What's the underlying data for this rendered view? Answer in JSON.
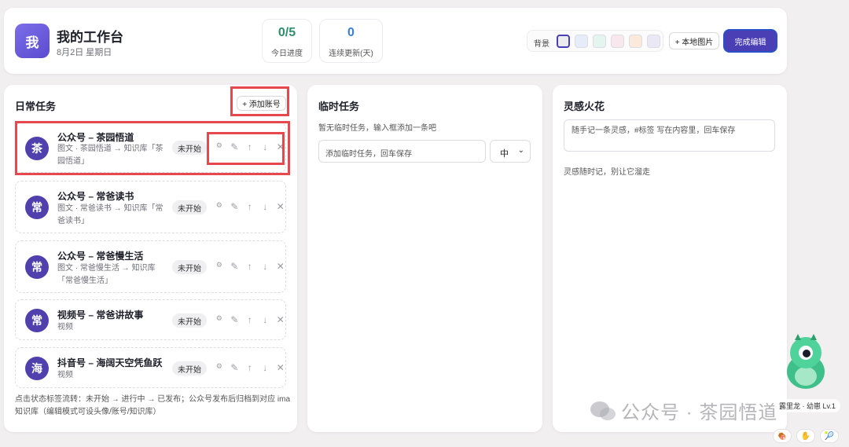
{
  "header": {
    "avatar_char": "我",
    "title": "我的工作台",
    "date": "8月2日 星期日",
    "stats": [
      {
        "value": "0/5",
        "label": "今日进度"
      },
      {
        "value": "0",
        "label": "连续更新(天)"
      }
    ],
    "bg_label": "背景",
    "bg_swatches": [
      "#ecebf0",
      "#e6ecf8",
      "#e4f4ee",
      "#f8e8ee",
      "#fbeadb",
      "#eae8f4"
    ],
    "local_image_label": "+ 本地图片",
    "done_label": "完成编辑"
  },
  "daily": {
    "title": "日常任务",
    "add_account_label": "+ 添加账号",
    "tasks": [
      {
        "avatar": "茶",
        "name": "公众号 – 茶园悟道",
        "desc": "图文 · 茶园悟道 → 知识库「茶园悟道」",
        "status": "未开始"
      },
      {
        "avatar": "常",
        "name": "公众号 – 常爸读书",
        "desc": "图文 · 常爸读书 → 知识库「常爸读书」",
        "status": "未开始"
      },
      {
        "avatar": "常",
        "name": "公众号 – 常爸慢生活",
        "desc": "图文 · 常爸慢生活 → 知识库「常爸慢生活」",
        "status": "未开始"
      },
      {
        "avatar": "常",
        "name": "视频号 – 常爸讲故事",
        "desc": "视频",
        "status": "未开始"
      },
      {
        "avatar": "海",
        "name": "抖音号 – 海阔天空凭鱼跃",
        "desc": "视频",
        "status": "未开始"
      }
    ],
    "ops": {
      "settings": "⚙",
      "edit": "✎",
      "up": "↑",
      "down": "↓",
      "delete": "✕"
    },
    "footer": "点击状态标签流转：未开始 → 进行中 → 已发布；公众号发布后归档到对应 ima 知识库（编辑模式可设头像/账号/知识库）"
  },
  "temp": {
    "title": "临时任务",
    "empty_text": "暂无临时任务，输入框添加一条吧",
    "input_placeholder": "添加临时任务，回车保存",
    "priority_value": "中"
  },
  "idea": {
    "title": "灵感火花",
    "input_placeholder": "随手记一条灵感，#标签 写在内容里，回车保存",
    "hint": "灵感随时记，别让它溜走"
  },
  "watermark": {
    "text": "公众号 · 茶园悟道"
  },
  "pet": {
    "label": "露里龙 · 幼崽 Lv.1",
    "buttons": [
      "🍖",
      "✋",
      "🎾"
    ]
  },
  "colors": {
    "accent": "#4a3fb5",
    "highlight": "#e5484d",
    "progress": "#2f8f6b",
    "streak": "#3b7fd6"
  }
}
